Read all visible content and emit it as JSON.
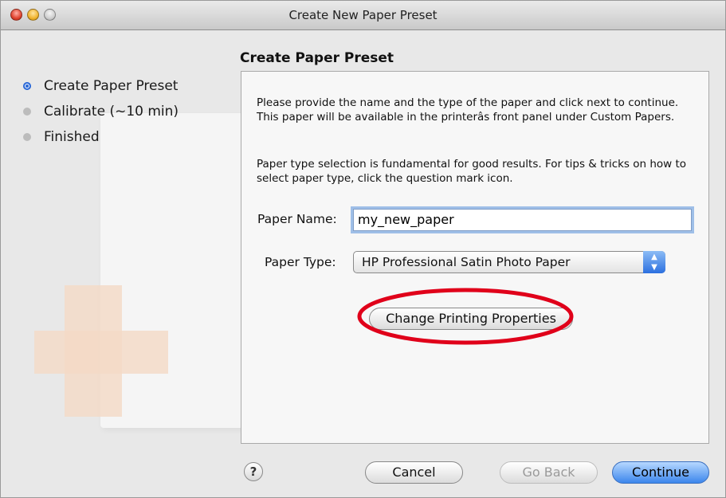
{
  "window": {
    "title": "Create New Paper Preset"
  },
  "steps": [
    {
      "label": "Create Paper Preset",
      "active": true
    },
    {
      "label": "Calibrate (~10 min)",
      "active": false
    },
    {
      "label": "Finished",
      "active": false
    }
  ],
  "panel": {
    "title": "Create Paper Preset",
    "description1": "Please provide the name and the type of the paper and click next to continue. This paper will be available in the printerâs front panel under Custom Papers.",
    "description2": "Paper type selection is fundamental for good results. For tips & tricks on how to select paper type, click the question mark icon.",
    "paper_name_label": "Paper Name:",
    "paper_name_value": "my_new_paper",
    "paper_type_label": "Paper Type:",
    "paper_type_value": "HP Professional Satin Photo Paper",
    "change_button": "Change Printing Properties"
  },
  "footer": {
    "help": "?",
    "cancel": "Cancel",
    "go_back": "Go Back",
    "continue": "Continue"
  },
  "colors": {
    "accent": "#2a68d6",
    "highlight_circle": "#e0001a",
    "cross_decoration": "#f4d9c6"
  }
}
